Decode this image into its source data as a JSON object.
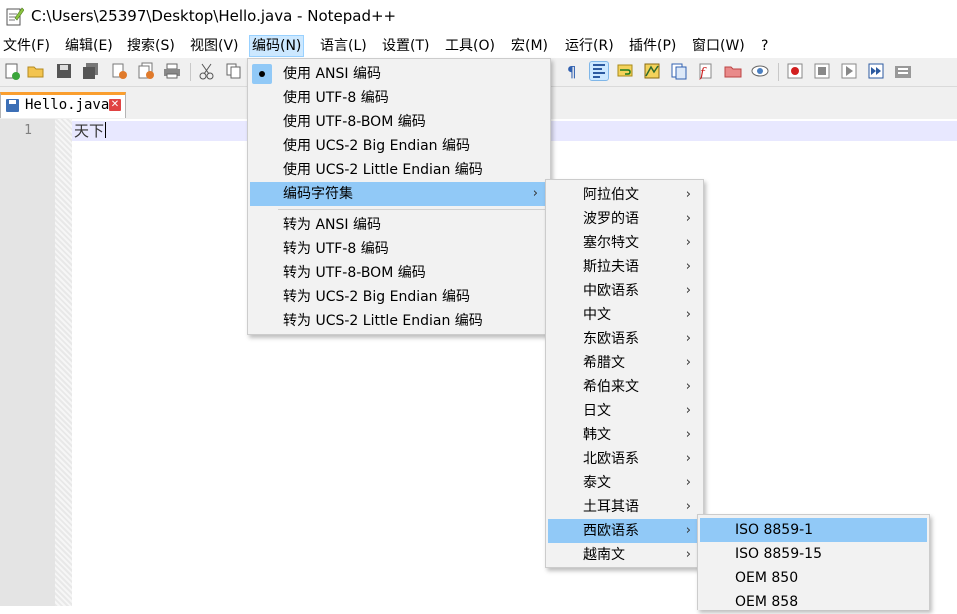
{
  "window": {
    "title": "C:\\Users\\25397\\Desktop\\Hello.java - Notepad++"
  },
  "menubar": {
    "items": [
      {
        "label": "文件(F)"
      },
      {
        "label": "编辑(E)"
      },
      {
        "label": "搜索(S)"
      },
      {
        "label": "视图(V)"
      },
      {
        "label": "编码(N)"
      },
      {
        "label": "语言(L)"
      },
      {
        "label": "设置(T)"
      },
      {
        "label": "工具(O)"
      },
      {
        "label": "宏(M)"
      },
      {
        "label": "运行(R)"
      },
      {
        "label": "插件(P)"
      },
      {
        "label": "窗口(W)"
      },
      {
        "label": "?"
      }
    ]
  },
  "tab": {
    "label": "Hello.java",
    "close_glyph": "✕"
  },
  "editor": {
    "line_number": "1",
    "text": "天下"
  },
  "encoding_menu": {
    "items": [
      {
        "label": "使用 ANSI 编码"
      },
      {
        "label": "使用 UTF-8 编码"
      },
      {
        "label": "使用 UTF-8-BOM 编码"
      },
      {
        "label": "使用 UCS-2 Big Endian 编码"
      },
      {
        "label": "使用 UCS-2 Little Endian 编码"
      },
      {
        "label": "编码字符集"
      },
      {
        "label": "转为 ANSI 编码"
      },
      {
        "label": "转为 UTF-8 编码"
      },
      {
        "label": "转为 UTF-8-BOM 编码"
      },
      {
        "label": "转为 UCS-2 Big Endian 编码"
      },
      {
        "label": "转为 UCS-2 Little Endian 编码"
      }
    ],
    "arrow": "›"
  },
  "charset_menu": {
    "items": [
      {
        "label": "阿拉伯文"
      },
      {
        "label": "波罗的语"
      },
      {
        "label": "塞尔特文"
      },
      {
        "label": "斯拉夫语"
      },
      {
        "label": "中欧语系"
      },
      {
        "label": "中文"
      },
      {
        "label": "东欧语系"
      },
      {
        "label": "希腊文"
      },
      {
        "label": "希伯来文"
      },
      {
        "label": "日文"
      },
      {
        "label": "韩文"
      },
      {
        "label": "北欧语系"
      },
      {
        "label": "泰文"
      },
      {
        "label": "土耳其语"
      },
      {
        "label": "西欧语系"
      },
      {
        "label": "越南文"
      }
    ]
  },
  "western_menu": {
    "items": [
      {
        "label": "ISO 8859-1"
      },
      {
        "label": "ISO 8859-15"
      },
      {
        "label": "OEM 850"
      },
      {
        "label": "OEM 858"
      }
    ]
  },
  "toolbar": {
    "icons": [
      "new-file-icon",
      "open-file-icon",
      "save-icon",
      "save-all-icon",
      "close-icon",
      "close-all-icon",
      "print-icon",
      "cut-icon",
      "copy-icon",
      "show-all-characters-icon",
      "indent-guide-icon",
      "word-wrap-icon",
      "document-map-icon",
      "function-list-icon",
      "folder-as-workspace-icon",
      "monitoring-icon",
      "record-macro-icon",
      "stop-macro-icon",
      "play-macro-icon",
      "run-macro-multiple-icon",
      "save-macro-icon"
    ]
  },
  "colors": {
    "menu_highlight": "#91c9f7",
    "menubar_active": "#cce8ff",
    "tab_accent": "#fa9e2e"
  }
}
